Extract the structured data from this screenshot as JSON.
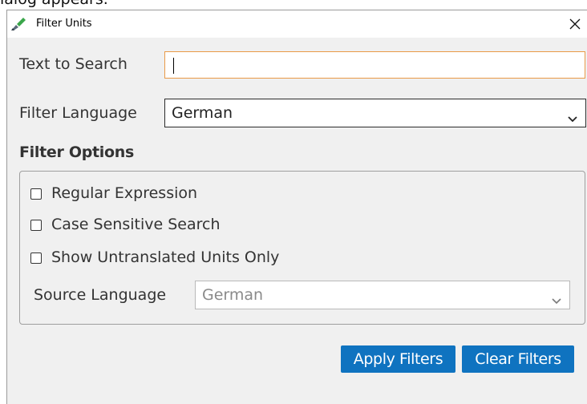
{
  "caption": "ialog appears.",
  "window": {
    "title": "Filter Units",
    "app_icon": "pencil-brush-icon",
    "close_icon": "close-icon"
  },
  "search": {
    "label": "Text to Search",
    "value": "",
    "placeholder": ""
  },
  "filter_language": {
    "label": "Filter Language",
    "selected": "German"
  },
  "filter_options": {
    "title": "Filter Options",
    "checkboxes": [
      {
        "label": "Regular Expression",
        "checked": false
      },
      {
        "label": "Case Sensitive Search",
        "checked": false
      },
      {
        "label": "Show Untranslated Units Only",
        "checked": false
      }
    ],
    "source_language": {
      "label": "Source Language",
      "selected": "German",
      "disabled": true
    }
  },
  "buttons": {
    "apply": "Apply Filters",
    "clear": "Clear Filters"
  },
  "colors": {
    "accent": "#0f73c0",
    "focus_border": "#e99a47",
    "background": "#f0f0f0"
  }
}
